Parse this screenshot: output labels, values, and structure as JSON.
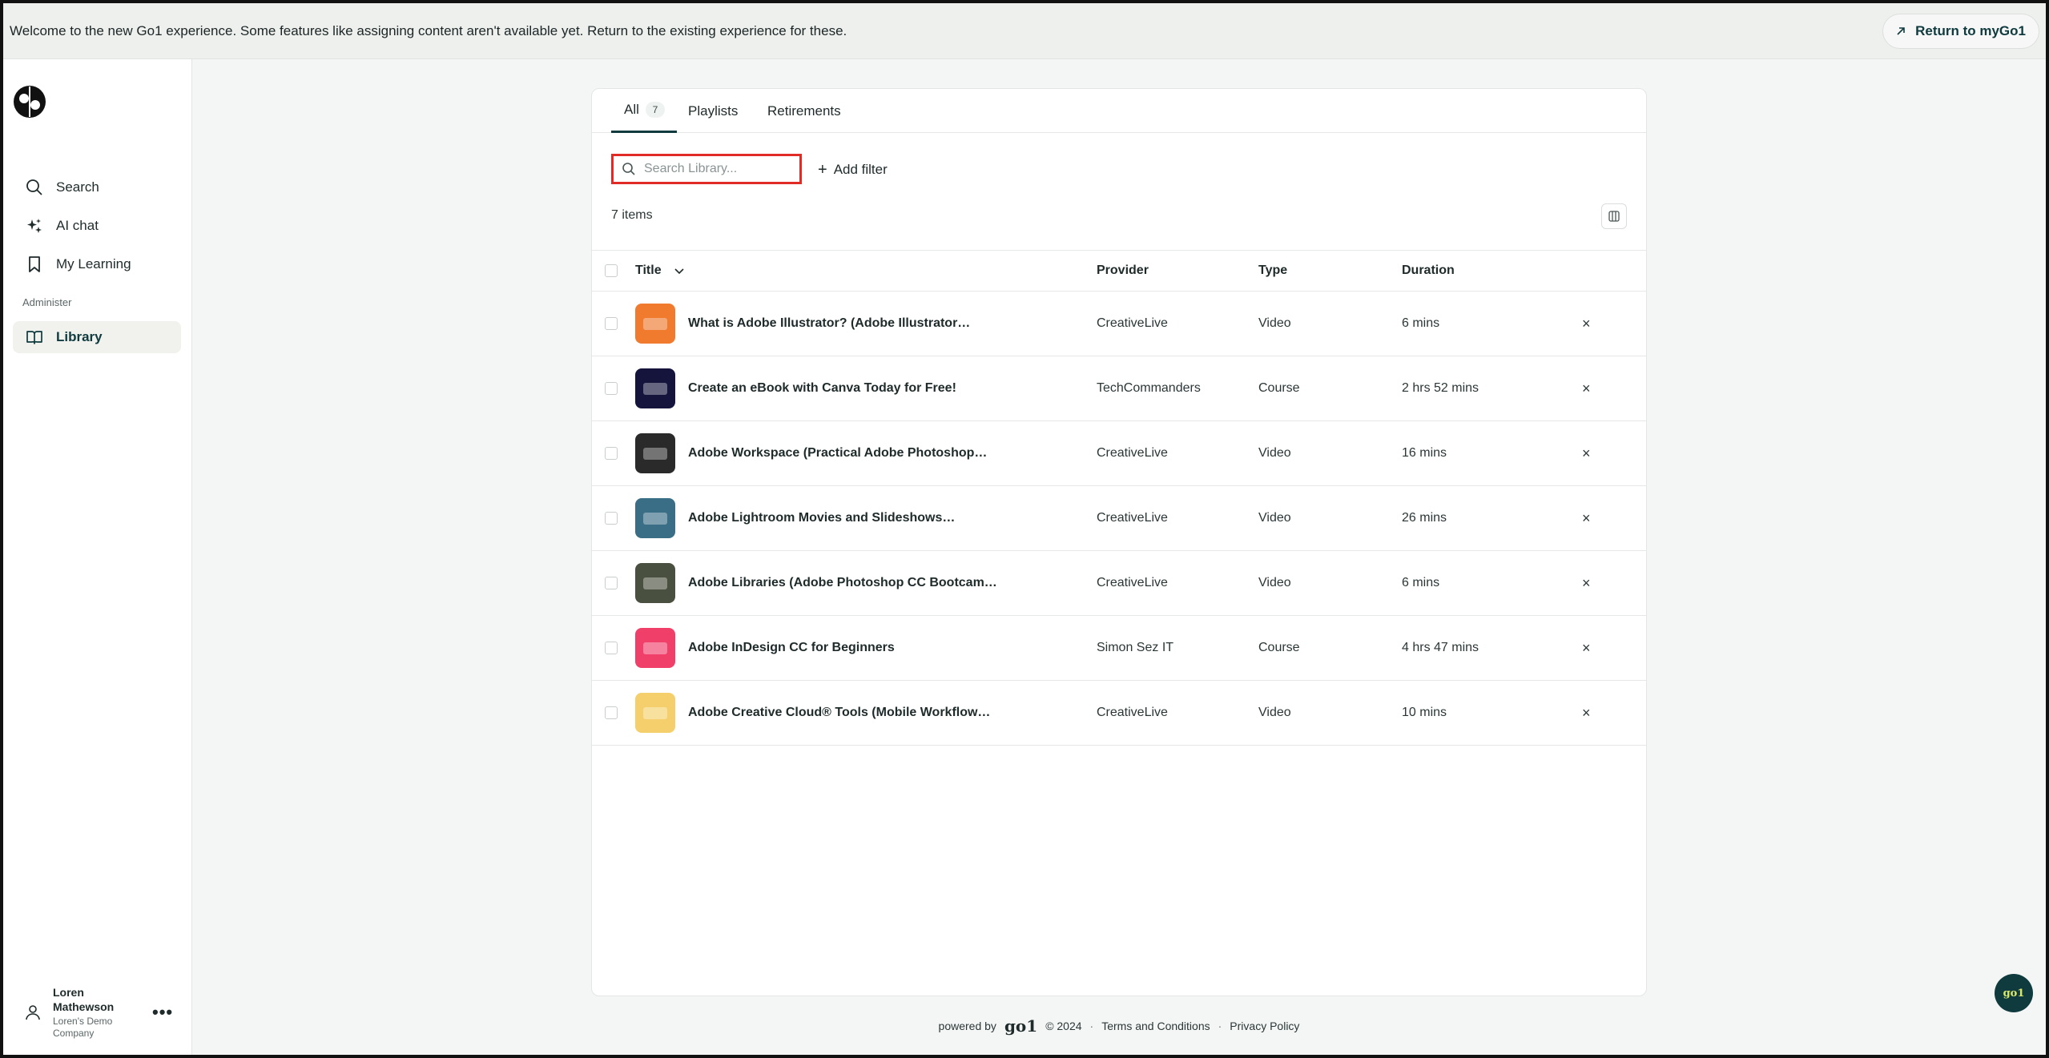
{
  "banner": {
    "text": "Welcome to the new Go1 experience. Some features like assigning content aren't available yet. Return to the existing experience for these.",
    "return_label": "Return to myGo1"
  },
  "sidebar": {
    "items": [
      {
        "label": "Search",
        "icon": "search-icon"
      },
      {
        "label": "AI chat",
        "icon": "sparkle-icon"
      },
      {
        "label": "My Learning",
        "icon": "bookmark-icon"
      }
    ],
    "section_label": "Administer",
    "admin_items": [
      {
        "label": "Library",
        "icon": "book-open-icon"
      }
    ]
  },
  "user": {
    "name": "Loren Mathewson",
    "company": "Loren's Demo Company"
  },
  "tabs": [
    {
      "label": "All",
      "count": "7"
    },
    {
      "label": "Playlists"
    },
    {
      "label": "Retirements"
    }
  ],
  "search": {
    "placeholder": "Search Library..."
  },
  "filter": {
    "add_label": "Add filter"
  },
  "items_count": "7 items",
  "table": {
    "headers": {
      "title": "Title",
      "provider": "Provider",
      "type": "Type",
      "duration": "Duration"
    },
    "rows": [
      {
        "title": "What is Adobe Illustrator? (Adobe Illustrator…",
        "provider": "CreativeLive",
        "type": "Video",
        "duration": "6 mins",
        "thumb_color": "#f07a2e"
      },
      {
        "title": "Create an eBook with Canva Today for Free!",
        "provider": "TechCommanders",
        "type": "Course",
        "duration": "2 hrs 52 mins",
        "thumb_color": "#14143c"
      },
      {
        "title": "Adobe Workspace (Practical Adobe Photoshop…",
        "provider": "CreativeLive",
        "type": "Video",
        "duration": "16 mins",
        "thumb_color": "#2a2a2a"
      },
      {
        "title": "Adobe Lightroom Movies and Slideshows…",
        "provider": "CreativeLive",
        "type": "Video",
        "duration": "26 mins",
        "thumb_color": "#3a6e86"
      },
      {
        "title": "Adobe Libraries (Adobe Photoshop CC Bootcam…",
        "provider": "CreativeLive",
        "type": "Video",
        "duration": "6 mins",
        "thumb_color": "#4a5040"
      },
      {
        "title": "Adobe InDesign CC for Beginners",
        "provider": "Simon Sez IT",
        "type": "Course",
        "duration": "4 hrs 47 mins",
        "thumb_color": "#f0406a"
      },
      {
        "title": "Adobe Creative Cloud® Tools (Mobile Workflow…",
        "provider": "CreativeLive",
        "type": "Video",
        "duration": "10 mins",
        "thumb_color": "#f5cf6b"
      }
    ],
    "remove_symbol": "×"
  },
  "footer": {
    "powered_by": "powered by",
    "brand": "go1",
    "copyright": "© 2024",
    "separator": "·",
    "terms": "Terms and Conditions",
    "privacy": "Privacy Policy"
  },
  "fab": {
    "label": "go1"
  }
}
